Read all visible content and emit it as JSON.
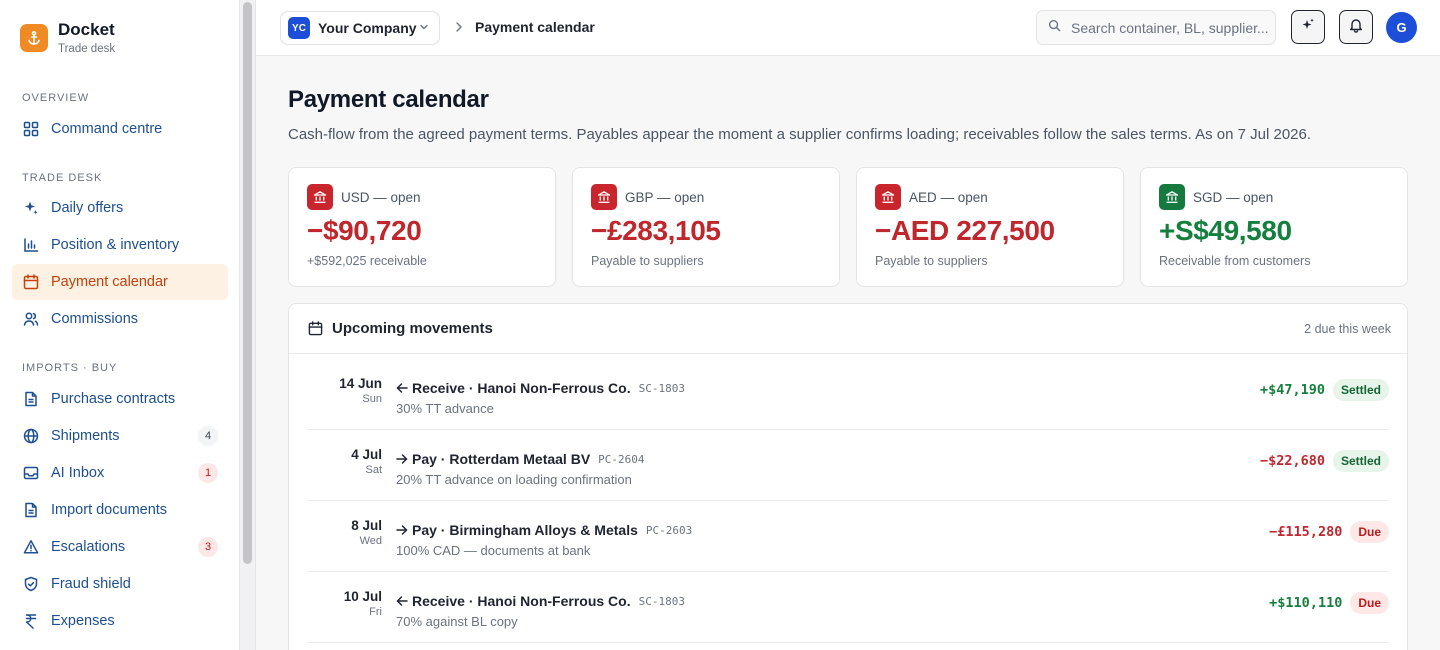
{
  "app": {
    "name": "Docket",
    "subtitle": "Trade desk"
  },
  "sidebar": {
    "sections": [
      {
        "label": "OVERVIEW"
      },
      {
        "label": "TRADE DESK"
      },
      {
        "label": "IMPORTS · BUY"
      }
    ],
    "items": [
      {
        "label": "Command centre",
        "icon": "grid-icon"
      },
      {
        "label": "Daily offers",
        "icon": "sparkle-icon"
      },
      {
        "label": "Position & inventory",
        "icon": "bar-chart-icon"
      },
      {
        "label": "Payment calendar",
        "icon": "calendar-icon",
        "active": true
      },
      {
        "label": "Commissions",
        "icon": "users-icon"
      },
      {
        "label": "Purchase contracts",
        "icon": "document-icon"
      },
      {
        "label": "Shipments",
        "icon": "globe-icon",
        "badge": "4"
      },
      {
        "label": "AI Inbox",
        "icon": "inbox-icon",
        "badge": "1"
      },
      {
        "label": "Import documents",
        "icon": "document-icon"
      },
      {
        "label": "Escalations",
        "icon": "warning-icon",
        "badge": "3"
      },
      {
        "label": "Fraud shield",
        "icon": "shield-icon"
      },
      {
        "label": "Expenses",
        "icon": "rupee-icon"
      }
    ]
  },
  "topbar": {
    "company_initials": "YC",
    "company_name": "Your Company",
    "breadcrumb": "Payment calendar",
    "search_placeholder": "Search container, BL, supplier...",
    "user_initial": "G"
  },
  "page": {
    "title": "Payment calendar",
    "description": "Cash-flow from the agreed payment terms. Payables appear the moment a supplier confirms loading; receivables follow the sales terms. As on 7 Jul 2026."
  },
  "cards": [
    {
      "label": "USD — open",
      "value": "−$90,720",
      "sub": "+$592,025 receivable",
      "tone": "negative"
    },
    {
      "label": "GBP — open",
      "value": "−£283,105",
      "sub": "Payable to suppliers",
      "tone": "negative"
    },
    {
      "label": "AED — open",
      "value": "−AED 227,500",
      "sub": "Payable to suppliers",
      "tone": "negative"
    },
    {
      "label": "SGD — open",
      "value": "+S$49,580",
      "sub": "Receivable from customers",
      "tone": "positive"
    }
  ],
  "movements": {
    "title": "Upcoming movements",
    "meta": "2 due this week",
    "rows": [
      {
        "day": "14 Jun",
        "weekday": "Sun",
        "direction": "in",
        "title": "Receive · Hanoi Non-Ferrous Co.",
        "ref": "SC-1803",
        "note": "30% TT advance",
        "amount": "+$47,190",
        "status": "Settled"
      },
      {
        "day": "4 Jul",
        "weekday": "Sat",
        "direction": "out",
        "title": "Pay · Rotterdam Metaal BV",
        "ref": "PC-2604",
        "note": "20% TT advance on loading confirmation",
        "amount": "−$22,680",
        "status": "Settled"
      },
      {
        "day": "8 Jul",
        "weekday": "Wed",
        "direction": "out",
        "title": "Pay · Birmingham Alloys & Metals",
        "ref": "PC-2603",
        "note": "100% CAD — documents at bank",
        "amount": "−£115,280",
        "status": "Due"
      },
      {
        "day": "10 Jul",
        "weekday": "Fri",
        "direction": "in",
        "title": "Receive · Hanoi Non-Ferrous Co.",
        "ref": "SC-1803",
        "note": "70% against BL copy",
        "amount": "+$110,110",
        "status": "Due"
      }
    ]
  },
  "colors": {
    "accent": "#f08a24",
    "link": "#1d4f91",
    "negative": "#c0272d",
    "positive": "#15803d"
  }
}
